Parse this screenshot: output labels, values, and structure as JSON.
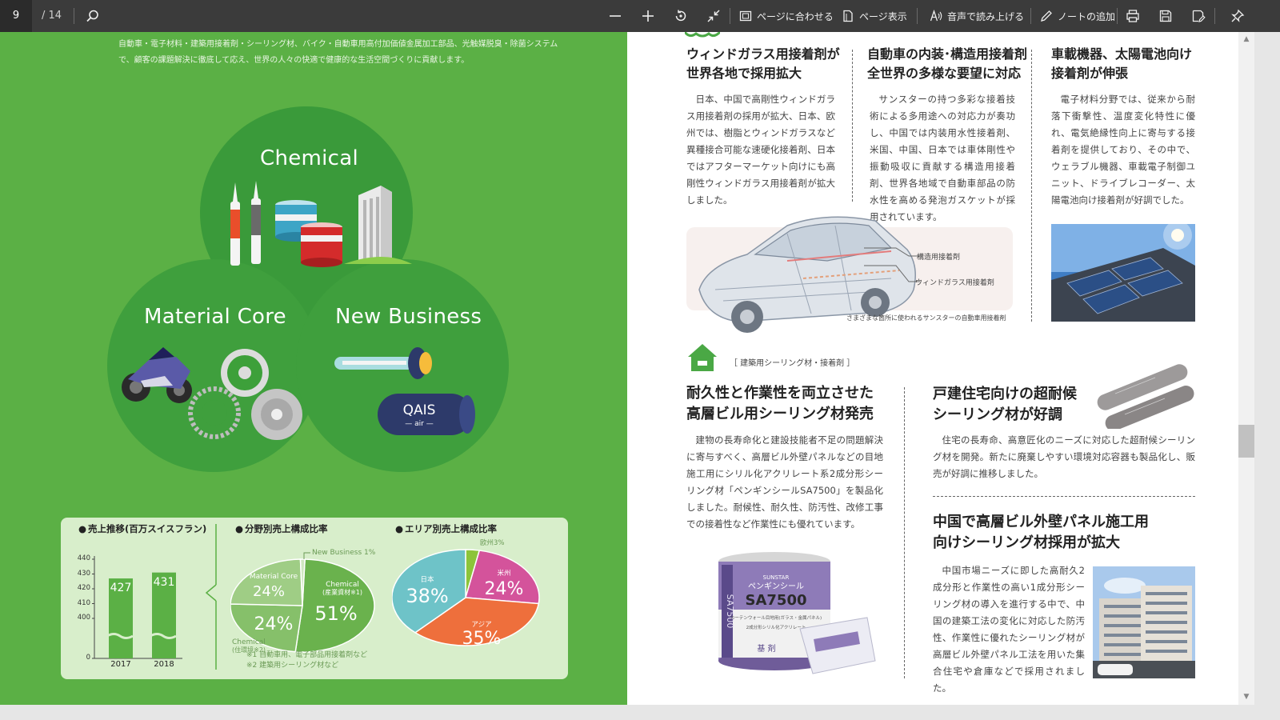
{
  "toolbar": {
    "page_current": "9",
    "page_total": "/ 14",
    "fit_page": "ページに合わせる",
    "page_view": "ページ表示",
    "read_aloud": "音声で読み上げる",
    "add_note": "ノートの追加"
  },
  "left_page": {
    "intro": "自動車・電子材料・建築用接着剤・シーリング材、バイク・自動車用高付加価値金属加工部品、光触媒脱臭・除菌システムで、顧客の課題解決に徹底して応え、世界の人々の快適で健康的な生活空間づくりに貢献します。",
    "venn": {
      "chemical": "Chemical",
      "material_core": "Material Core",
      "new_business": "New Business",
      "qais": "QAIS",
      "qais_sub": "— air —"
    },
    "stats": {
      "sales_title": "売上推移(百万スイスフラン)",
      "segment_title": "分野別売上構成比率",
      "area_title": "エリア別売上構成比率",
      "notes": [
        "※1 自動車用、電子部品用接着剤など",
        "※2 建築用シーリング材など"
      ]
    }
  },
  "chart_data": [
    {
      "type": "bar",
      "title": "売上推移(百万スイスフラン)",
      "categories": [
        "2017",
        "2018"
      ],
      "values": [
        427,
        431
      ],
      "y_ticks": [
        "440",
        "430",
        "420",
        "410",
        "400",
        "0"
      ],
      "ylim": [
        0,
        440
      ],
      "axis_break": true
    },
    {
      "type": "pie",
      "title": "分野別売上構成比率",
      "labels": [
        "Chemical\n(産業資材※1)",
        "Chemical\n(住環境※2)",
        "Material Core",
        "New Business"
      ],
      "values": [
        51,
        24,
        24,
        1
      ],
      "value_labels": [
        "51%",
        "24%",
        "24%",
        "1%"
      ],
      "colors": [
        "#6ab24d",
        "#86c06a",
        "#9fcd85",
        "#cfe7c0"
      ]
    },
    {
      "type": "pie",
      "title": "エリア別売上構成比率",
      "labels": [
        "欧州",
        "米州",
        "アジア",
        "日本"
      ],
      "values": [
        3,
        24,
        35,
        38
      ],
      "value_labels": [
        "3%",
        "24%",
        "35%",
        "38%"
      ],
      "colors": [
        "#8cc43a",
        "#d4539b",
        "#ee6f3c",
        "#6ec3c8"
      ]
    }
  ],
  "right_page": {
    "col1": {
      "heading": "ウィンドガラス用接着剤が\n世界各地で採用拡大",
      "body": "日本、中国で高剛性ウィンドガラス用接着剤の採用が拡大、日本、欧州では、樹脂とウィンドガラスなど異種接合可能な速硬化接着剤、日本ではアフターマーケット向けにも高剛性ウィンドガラス用接着剤が拡大しました。"
    },
    "col2": {
      "heading": "自動車の内装･構造用接着剤\n全世界の多様な要望に対応",
      "body": "サンスターの持つ多彩な接着技術による多用途への対応力が奏功し、中国では内装用水性接着剤、米国、中国、日本では車体剛性や振動吸収に貢献する構造用接着剤、世界各地域で自動車部品の防水性を高める発泡ガスケットが採用されています。"
    },
    "col3": {
      "heading": "車載機器、太陽電池向け\n接着剤が伸張",
      "body": "電子材料分野では、従来から耐落下衝撃性、温度変化特性に優れ、電気絶縁性向上に寄与する接着剤を提供しており、その中で、ウェラブル機器、車載電子制御ユニット、ドライブレコーダー、太陽電池向け接着剤が好調でした。"
    },
    "car_labels": {
      "structural": "構造用接着剤",
      "windshield": "ウィンドガラス用接着剤",
      "caption": "さまざまな箇所に使われるサンスターの自動車用接着剤"
    },
    "section_tag": "［ 建築用シーリング材・接着剤 ］",
    "sec2_left": {
      "heading": "耐久性と作業性を両立させた\n高層ビル用シーリング材発売",
      "body": "建物の長寿命化と建設技能者不足の問題解決に寄与すべく、高層ビル外壁パネルなどの目地施工用にシリル化アクリレート系2成分形シーリング材「ペンギンシールSA7500」を製品化しました。耐候性、耐久性、防汚性、改修工事での接着性など作業性にも優れています。"
    },
    "product": {
      "brand": "SUNSTAR",
      "name_jp": "ペンギンシール",
      "model": "SA7500",
      "side": "SA7500",
      "sub": "カーテンウォール目地用(ガラス・金属パネル)",
      "sub2": "2成分形シリル化アクリレート",
      "base": "基 剤"
    },
    "sec2_right_top": {
      "heading": "戸建住宅向けの超耐候\nシーリング材が好調",
      "body": "住宅の長寿命、高意匠化のニーズに対応した超耐候シーリング材を開発。新たに廃棄しやすい環境対応容器も製品化し、販売が好調に推移しました。"
    },
    "sec2_right_bottom": {
      "heading": "中国で高層ビル外壁パネル施工用\n向けシーリング材採用が拡大",
      "body": "中国市場ニーズに即した高耐久2成分形と作業性の高い1成分形シーリング材の導入を進行する中で、中国の建築工法の変化に対応した防汚性、作業性に優れたシーリング材が高層ビル外壁パネル工法を用いた集合住宅や倉庫などで採用されました。"
    }
  },
  "colors": {
    "green_bg": "#5bb045",
    "circle_green": "#3f9f3d",
    "stats_bg": "#d8eecb",
    "toolbar_bg": "#3b3b3b"
  },
  "icons": [
    "search-icon",
    "minus-icon",
    "plus-icon",
    "rotate-icon",
    "collapse-icon",
    "fit-page-icon",
    "page-view-icon",
    "read-aloud-icon",
    "pen-icon",
    "print-icon",
    "save-icon",
    "save-as-icon",
    "pin-icon"
  ]
}
